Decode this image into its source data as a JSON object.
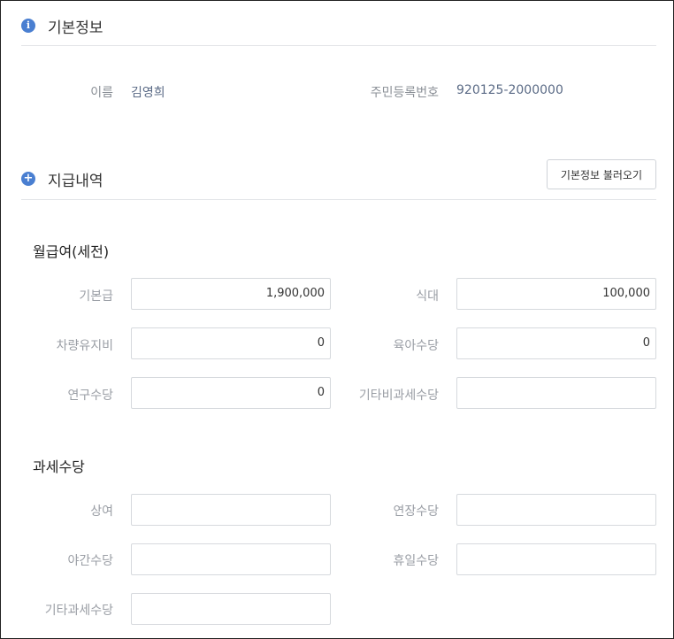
{
  "basic": {
    "title": "기본정보",
    "name_label": "이름",
    "name_value": "김영희",
    "rrn_label": "주민등록번호",
    "rrn_value": "920125-2000000"
  },
  "payment": {
    "title": "지급내역",
    "load_button": "기본정보 불러오기"
  },
  "monthly": {
    "title": "월급여(세전)",
    "fields": [
      {
        "label": "기본급",
        "value": "1,900,000"
      },
      {
        "label": "식대",
        "value": "100,000"
      },
      {
        "label": "차량유지비",
        "value": "0"
      },
      {
        "label": "육아수당",
        "value": "0"
      },
      {
        "label": "연구수당",
        "value": "0"
      },
      {
        "label": "기타비과세수당",
        "value": ""
      }
    ]
  },
  "taxable": {
    "title": "과세수당",
    "fields": [
      {
        "label": "상여",
        "value": ""
      },
      {
        "label": "연장수당",
        "value": ""
      },
      {
        "label": "야간수당",
        "value": ""
      },
      {
        "label": "휴일수당",
        "value": ""
      },
      {
        "label": "기타과세수당",
        "value": ""
      }
    ]
  },
  "colors": {
    "accent": "#4a7fd1",
    "label": "#9a9ea5",
    "value": "#5b6b86"
  }
}
